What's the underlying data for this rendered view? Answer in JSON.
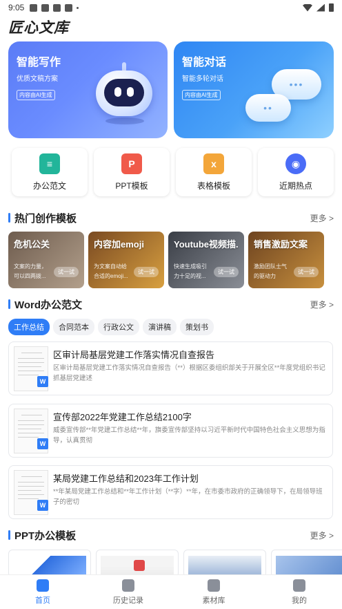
{
  "status_bar": {
    "time": "9:05"
  },
  "app": {
    "title": "匠心文库"
  },
  "hero_cards": [
    {
      "title": "智能写作",
      "subtitle": "优质文稿方案",
      "badge": "内容由AI生成"
    },
    {
      "title": "智能对话",
      "subtitle": "智能多轮对话",
      "badge": "内容由AI生成"
    }
  ],
  "quick_entries": [
    {
      "label": "办公范文",
      "icon": "doc-icon",
      "color": "#22b59a"
    },
    {
      "label": "PPT模板",
      "icon": "ppt-icon",
      "color": "#f05a4a"
    },
    {
      "label": "表格模板",
      "icon": "excel-icon",
      "color": "#f3a63a"
    },
    {
      "label": "近期热点",
      "icon": "flame-icon",
      "color": "#4a6cf7"
    }
  ],
  "hot_section": {
    "title": "热门创作模板",
    "more": "更多 >",
    "cards": [
      {
        "title": "危机公关",
        "desc": "文案的力量，可以四两拨...",
        "try": "试一试",
        "color": "#8a7766"
      },
      {
        "title": "内容加emoji",
        "desc": "为文案自动给合适的emoji...",
        "try": "试一试",
        "color": "#9a6a2e"
      },
      {
        "title": "Youtube视频描...",
        "desc": "快速生成吸引力十足的视...",
        "try": "试一试",
        "color": "#5a5e66"
      },
      {
        "title": "销售激励文案",
        "desc": "激励团队士气的驱动力",
        "try": "试一试",
        "color": "#8a5c2c"
      }
    ]
  },
  "word_section": {
    "title": "Word办公范文",
    "more": "更多 >",
    "tabs": [
      "工作总结",
      "合同范本",
      "行政公文",
      "演讲稿",
      "策划书"
    ],
    "active_tab": 0,
    "docs": [
      {
        "title": "区审计局基层党建工作落实情况自查报告",
        "desc": "区审计局基层党建工作落实情况自查报告（**）根据区委组织部关于开展全区**年度党组织书记抓基层党建述",
        "badge": "W"
      },
      {
        "title": "宣传部2022年党建工作总结2100字",
        "desc": "威委宣传部**年党建工作总结**年，旗委宣传部坚持以习近平新时代中国特色社会主义思想为指导，认真贯彻",
        "badge": "W"
      },
      {
        "title": "某局党建工作总结和2023年工作计划",
        "desc": "**年某局党建工作总结和**年工作计划（**字）**年，在市委市政府的正确领导下，在局领导班子的密切",
        "badge": "W"
      }
    ]
  },
  "ppt_section": {
    "title": "PPT办公模板",
    "more": "更多 >",
    "thumbs": [
      {
        "color": "#2f6fe0"
      },
      {
        "color": "#e04848"
      },
      {
        "color": "#5a7fb8"
      },
      {
        "color": "#7aa0d8"
      }
    ]
  },
  "bottom_nav": [
    {
      "label": "首页",
      "icon": "home-icon",
      "active": true
    },
    {
      "label": "历史记录",
      "icon": "history-icon",
      "active": false
    },
    {
      "label": "素材库",
      "icon": "library-icon",
      "active": false
    },
    {
      "label": "我的",
      "icon": "profile-icon",
      "active": false
    }
  ],
  "colors": {
    "accent": "#2f7df6"
  }
}
